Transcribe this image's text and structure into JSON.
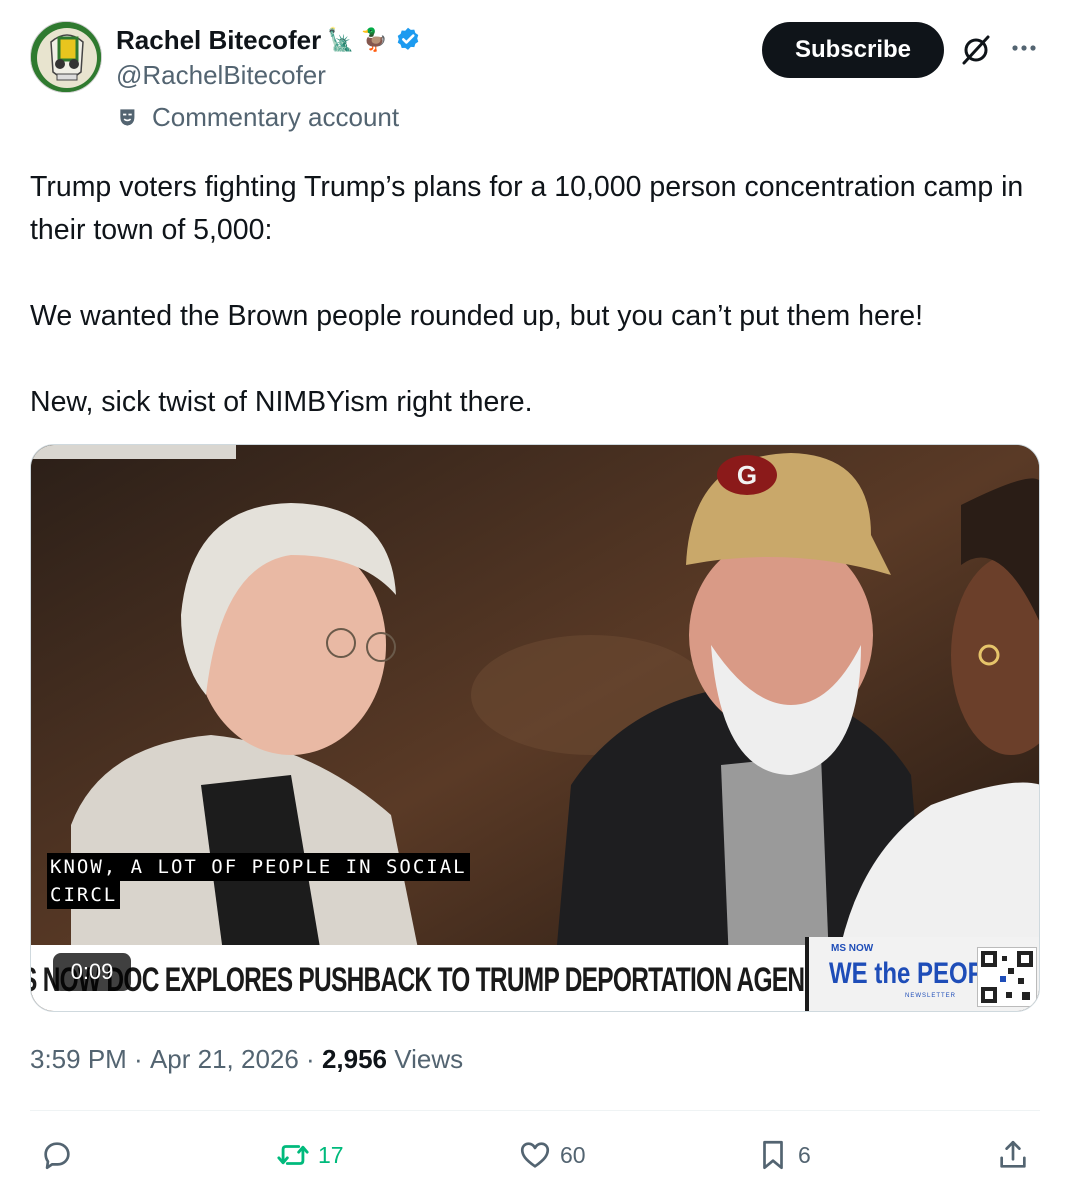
{
  "author": {
    "display_name": "Rachel Bitecofer",
    "emojis": [
      "🗽",
      "🦆"
    ],
    "handle": "@RachelBitecofer",
    "account_label": "Commentary account",
    "verified_color": "#1d9bf0"
  },
  "header": {
    "subscribe_label": "Subscribe"
  },
  "tweet": {
    "paragraphs": [
      "Trump voters fighting Trump’s plans for a 10,000 person concentration camp in their town of 5,000:",
      "We wanted the Brown people rounded up, but you can’t put them here!",
      "New, sick twist of NIMBYism right there."
    ]
  },
  "media": {
    "caption_line1": "KNOW, A LOT OF PEOPLE IN SOCIAL",
    "caption_line2": "CIRCL",
    "chyron": "S NOW DOC EXPLORES PUSHBACK TO TRUMP DEPORTATION AGENDA",
    "promo_network": "MS NOW",
    "promo_title": "WE the PEOPLE",
    "promo_sub": "NEWSLETTER",
    "duration": "0:09"
  },
  "meta": {
    "time": "3:59 PM",
    "separator": " · ",
    "date": "Apr 21, 2026",
    "views_count": "2,956",
    "views_label": " Views"
  },
  "actions": {
    "replies": "",
    "reposts": "17",
    "likes": "60",
    "bookmarks": "6",
    "repost_color": "#00ba7c"
  }
}
